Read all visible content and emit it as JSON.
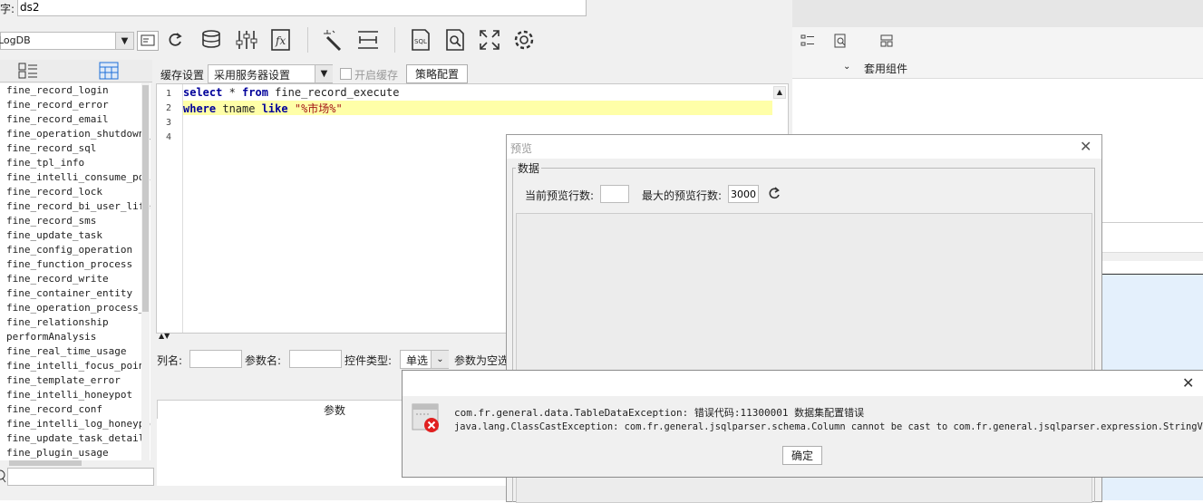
{
  "top": {
    "name_label": "字:",
    "name_value": "ds2"
  },
  "db_select": {
    "value": "LogDB"
  },
  "cache": {
    "label": "缓存设置",
    "value": "采用服务器设置",
    "enable_label": "开启缓存",
    "policy_button": "策略配置"
  },
  "tables": [
    "fine_record_login",
    "fine_record_error",
    "fine_record_email",
    "fine_operation_shutdown_r",
    "fine_record_sql",
    "fine_tpl_info",
    "fine_intelli_consume_poin",
    "fine_record_lock",
    "fine_record_bi_user_lifec",
    "fine_record_sms",
    "fine_update_task",
    "fine_config_operation",
    "fine_function_process",
    "fine_record_write",
    "fine_container_entity",
    "fine_operation_process_lo",
    "fine_relationship",
    "performAnalysis",
    "fine_real_time_usage",
    "fine_intelli_focus_point",
    "fine_template_error",
    "fine_intelli_honeypot",
    "fine_record_conf",
    "fine_intelli_log_honeypot",
    "fine_update_task_detail",
    "fine_plugin_usage"
  ],
  "sql": {
    "line_numbers": [
      "1",
      "2",
      "3",
      "4"
    ],
    "line1": {
      "k1": "select",
      "t1": " * ",
      "k2": "from",
      "t2": " fine_record_execute"
    },
    "line2": {
      "k1": "where",
      "t1": " tname ",
      "k2": "like",
      "t2": " ",
      "s": "\"%市场%\""
    }
  },
  "params": {
    "col_label": "列名:",
    "param_label": "参数名:",
    "widget_label": "控件类型:",
    "widget_value": "单选",
    "empty_label": "参数为空选",
    "header": "参数"
  },
  "right_panel": {
    "group_label": "套用组件"
  },
  "preview": {
    "title": "预览",
    "group_label": "数据",
    "current_rows_label": "当前预览行数:",
    "current_rows_value": "",
    "max_rows_label": "最大的预览行数:",
    "max_rows_value": "3000"
  },
  "error": {
    "line1": "com.fr.general.data.TableDataException: 错误代码:11300001 数据集配置错误",
    "line2": "java.lang.ClassCastException: com.fr.general.jsqlparser.schema.Column cannot be cast to com.fr.general.jsqlparser.expression.StringValue",
    "ok_button": "确定"
  },
  "colors": {
    "accent": "#1e6fd9",
    "highlight": "#ffffa8",
    "error_red": "#e02020"
  }
}
